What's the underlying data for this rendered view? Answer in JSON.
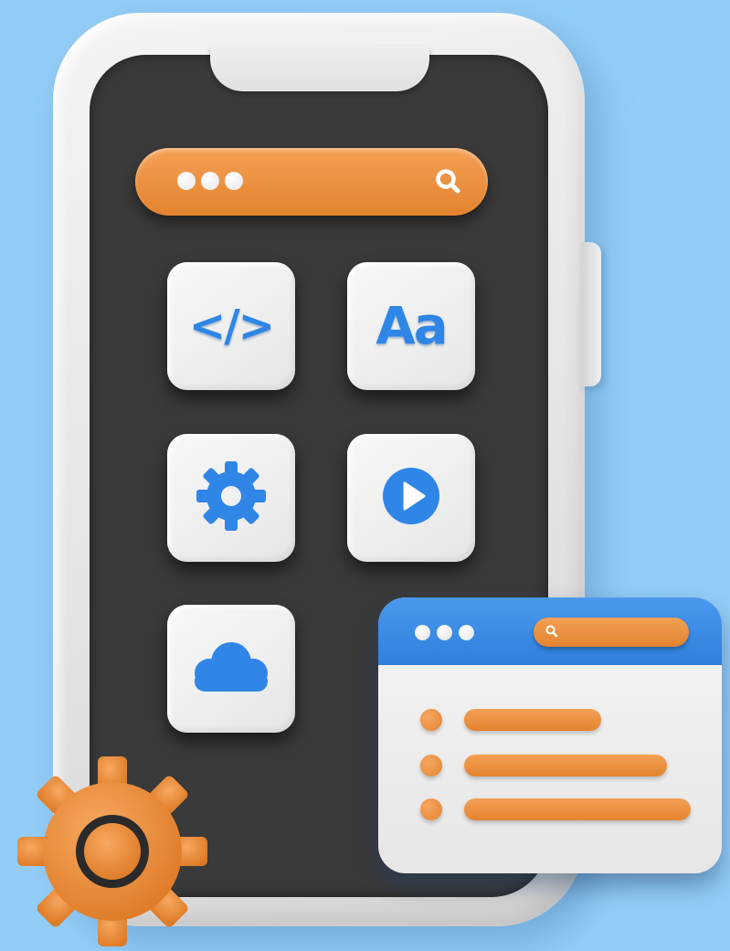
{
  "apps": [
    {
      "name": "code",
      "label": "</>",
      "icon": "code-icon"
    },
    {
      "name": "fonts",
      "label": "Aa",
      "icon": "font-icon"
    },
    {
      "name": "settings",
      "label": "",
      "icon": "gear-icon"
    },
    {
      "name": "video",
      "label": "",
      "icon": "play-icon"
    },
    {
      "name": "cloud",
      "label": "",
      "icon": "cloud-icon"
    }
  ],
  "colors": {
    "background": "#93cdf7",
    "screen": "#3a3a3a",
    "orange": "#e4832e",
    "blue": "#2f86e6",
    "tile": "#f0f0f0"
  },
  "icons": [
    "search-icon",
    "code-icon",
    "font-icon",
    "gear-icon",
    "play-icon",
    "cloud-icon",
    "large-gear-icon"
  ]
}
